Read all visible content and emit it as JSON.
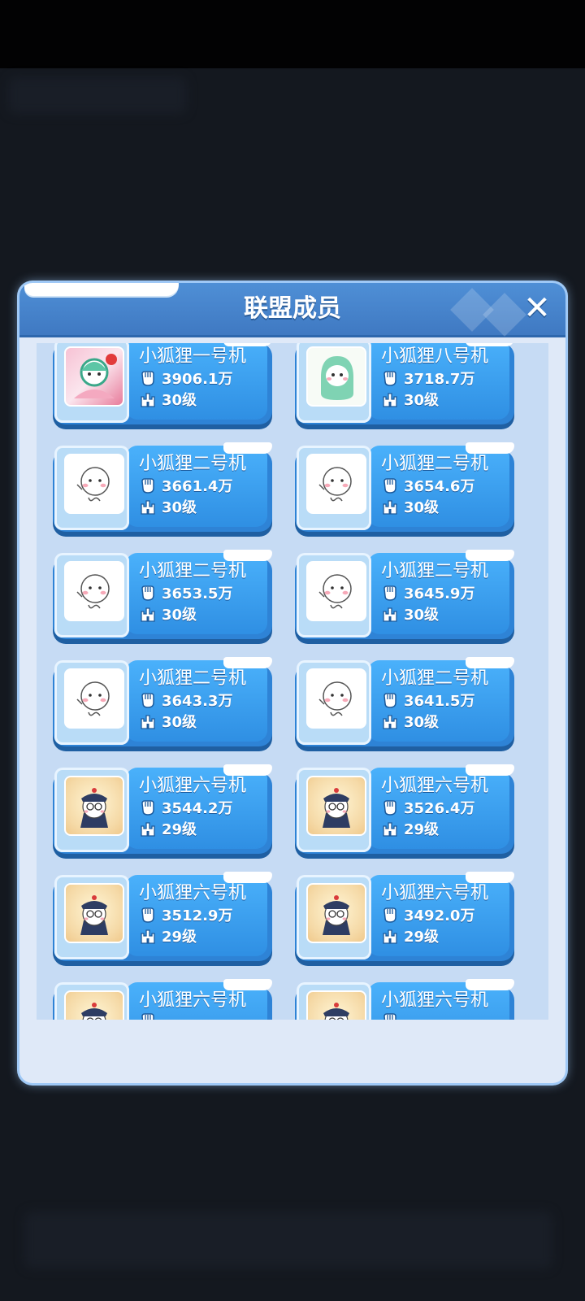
{
  "dialog": {
    "title": "联盟成员",
    "close_label": "✕"
  },
  "icons": {
    "power": "fist-icon",
    "level": "castle-icon",
    "close": "close-icon"
  },
  "members": [
    {
      "name": "小狐狸一号机",
      "power": "3906.1万",
      "level": "30级",
      "avatar": "pink-anime-avatar"
    },
    {
      "name": "小狐狸八号机",
      "power": "3718.7万",
      "level": "30级",
      "avatar": "green-dino-avatar"
    },
    {
      "name": "小狐狸二号机",
      "power": "3661.4万",
      "level": "30级",
      "avatar": "doodle-face-avatar"
    },
    {
      "name": "小狐狸二号机",
      "power": "3654.6万",
      "level": "30级",
      "avatar": "doodle-face-avatar"
    },
    {
      "name": "小狐狸二号机",
      "power": "3653.5万",
      "level": "30级",
      "avatar": "doodle-face-avatar"
    },
    {
      "name": "小狐狸二号机",
      "power": "3645.9万",
      "level": "30级",
      "avatar": "doodle-face-avatar"
    },
    {
      "name": "小狐狸二号机",
      "power": "3643.3万",
      "level": "30级",
      "avatar": "doodle-face-avatar"
    },
    {
      "name": "小狐狸二号机",
      "power": "3641.5万",
      "level": "30级",
      "avatar": "doodle-face-avatar"
    },
    {
      "name": "小狐狸六号机",
      "power": "3544.2万",
      "level": "29级",
      "avatar": "official-hat-avatar"
    },
    {
      "name": "小狐狸六号机",
      "power": "3526.4万",
      "level": "29级",
      "avatar": "official-hat-avatar"
    },
    {
      "name": "小狐狸六号机",
      "power": "3512.9万",
      "level": "29级",
      "avatar": "official-hat-avatar"
    },
    {
      "name": "小狐狸六号机",
      "power": "3492.0万",
      "level": "29级",
      "avatar": "official-hat-avatar"
    },
    {
      "name": "小狐狸六号机",
      "power": "",
      "level": "",
      "avatar": "official-hat-avatar"
    },
    {
      "name": "小狐狸六号机",
      "power": "",
      "level": "",
      "avatar": "official-hat-avatar"
    }
  ]
}
